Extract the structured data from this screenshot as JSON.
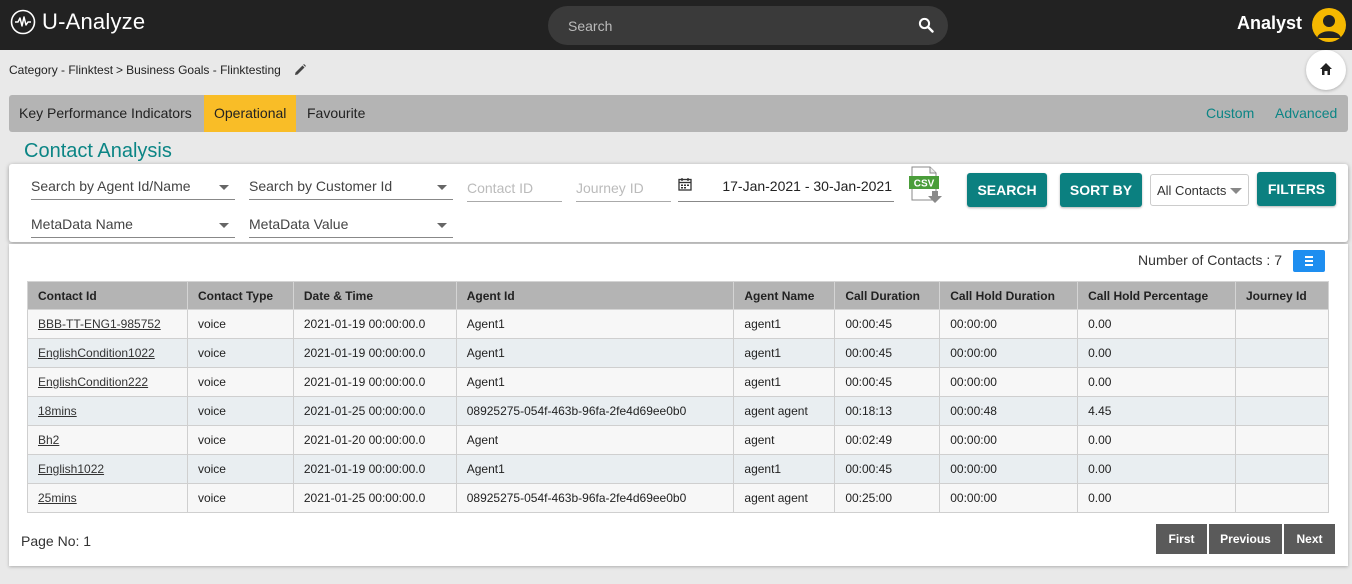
{
  "app": {
    "name": "U-Analyze",
    "search_placeholder": "Search",
    "user": "Analyst"
  },
  "breadcrumb": {
    "category": "Category - Flinktest",
    "separator": ">",
    "goals": "Business Goals - Flinktesting"
  },
  "tabs": {
    "left": [
      "Key Performance Indicators",
      "Operational",
      "Favourite"
    ],
    "active": "Operational",
    "right": [
      "Custom",
      "Advanced"
    ]
  },
  "page_title": "Contact Analysis",
  "filters": {
    "agent": "Search by Agent Id/Name",
    "customer": "Search by Customer Id",
    "contact_id_placeholder": "Contact ID",
    "journey_id_placeholder": "Journey ID",
    "date_range": "17-Jan-2021 - 30-Jan-2021",
    "metadata_name": "MetaData Name",
    "metadata_value": "MetaData Value",
    "search_button": "SEARCH",
    "sort_button": "SORT BY",
    "contacts_select": "All Contacts",
    "filters_button": "FILTERS",
    "csv_label": "CSV"
  },
  "results": {
    "count_label": "Number of Contacts : 7",
    "columns": [
      "Contact Id",
      "Contact Type",
      "Date & Time",
      "Agent Id",
      "Agent Name",
      "Call Duration",
      "Call Hold Duration",
      "Call Hold Percentage",
      "Journey Id"
    ],
    "rows": [
      [
        "BBB-TT-ENG1-985752",
        "voice",
        "2021-01-19 00:00:00.0",
        "Agent1",
        "agent1",
        "00:00:45",
        "00:00:00",
        "0.00",
        ""
      ],
      [
        "EnglishCondition1022",
        "voice",
        "2021-01-19 00:00:00.0",
        "Agent1",
        "agent1",
        "00:00:45",
        "00:00:00",
        "0.00",
        ""
      ],
      [
        "EnglishCondition222",
        "voice",
        "2021-01-19 00:00:00.0",
        "Agent1",
        "agent1",
        "00:00:45",
        "00:00:00",
        "0.00",
        ""
      ],
      [
        "18mins",
        "voice",
        "2021-01-25 00:00:00.0",
        "08925275-054f-463b-96fa-2fe4d69ee0b0",
        "agent agent",
        "00:18:13",
        "00:00:48",
        "4.45",
        ""
      ],
      [
        "Bh2",
        "voice",
        "2021-01-20 00:00:00.0",
        "Agent",
        "agent",
        "00:02:49",
        "00:00:00",
        "0.00",
        ""
      ],
      [
        "English1022",
        "voice",
        "2021-01-19 00:00:00.0",
        "Agent1",
        "agent1",
        "00:00:45",
        "00:00:00",
        "0.00",
        ""
      ],
      [
        "25mins",
        "voice",
        "2021-01-25 00:00:00.0",
        "08925275-054f-463b-96fa-2fe4d69ee0b0",
        "agent agent",
        "00:25:00",
        "00:00:00",
        "0.00",
        ""
      ]
    ]
  },
  "pager": {
    "page_label": "Page No: 1",
    "first": "First",
    "previous": "Previous",
    "next": "Next"
  },
  "colors": {
    "accent": "#0b8080",
    "active_tab": "#f9bd27",
    "topbar": "#222222"
  }
}
